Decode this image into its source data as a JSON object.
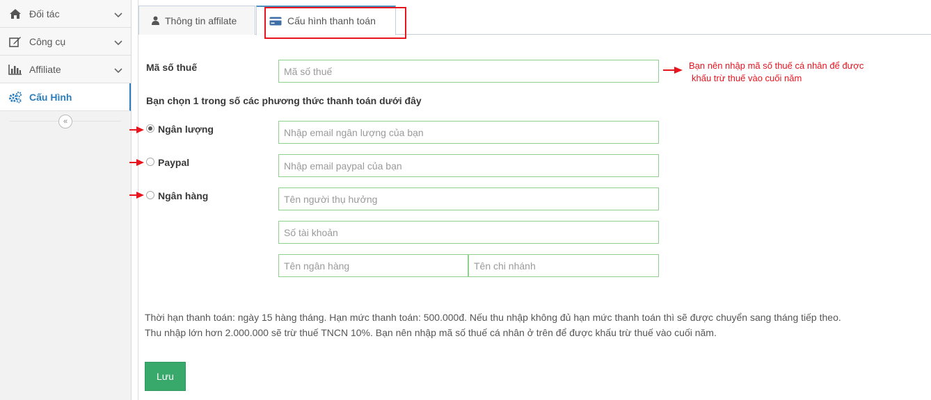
{
  "sidebar": {
    "items": [
      {
        "label": "Đối tác",
        "icon": "home-icon"
      },
      {
        "label": "Công cụ",
        "icon": "edit-icon"
      },
      {
        "label": "Affiliate",
        "icon": "bar-chart-icon"
      },
      {
        "label": "Cấu Hình",
        "icon": "cogs-icon"
      }
    ],
    "collapse_glyph": "«"
  },
  "tabs": [
    {
      "label": "Thông tin affilate",
      "icon": "user-icon"
    },
    {
      "label": "Cấu hình thanh toán",
      "icon": "credit-card-icon"
    }
  ],
  "form": {
    "tax_label": "Mã số thuế",
    "tax_placeholder": "Mã số thuế",
    "tax_note_line1": "Bạn nên nhập mã số thuế cá nhân để được",
    "tax_note_line2": "khấu trừ thuế vào cuối năm",
    "method_heading": "Bạn chọn 1 trong số các phương thức thanh toán dưới đây",
    "nganluong_label": "Ngân lượng",
    "nganluong_placeholder": "Nhập email ngân lượng của bạn",
    "paypal_label": "Paypal",
    "paypal_placeholder": "Nhập email paypal của bạn",
    "bank_label": "Ngân hàng",
    "beneficiary_placeholder": "Tên người thụ hưởng",
    "account_placeholder": "Số tài khoản",
    "bank_name_placeholder": "Tên ngân hàng",
    "branch_placeholder": "Tên chi nhánh",
    "selected_method": "Ngân lượng"
  },
  "info": {
    "line1": "Thời hạn thanh toán: ngày 15 hàng tháng. Hạn mức thanh toán: 500.000đ. Nếu thu nhập không đủ hạn mức thanh toán thì sẽ được chuyển sang tháng tiếp theo.",
    "line2": "Thu nhập lớn hơn 2.000.000 sẽ trừ thuế TNCN 10%. Bạn nên nhập mã số thuế cá nhân ở trên để được khấu trừ thuế vào cuối năm."
  },
  "save_label": "Lưu",
  "colors": {
    "accent": "#2b7dbc",
    "annotation": "#e8141e",
    "save": "#38a96b",
    "input_border": "#8fcf8f"
  }
}
